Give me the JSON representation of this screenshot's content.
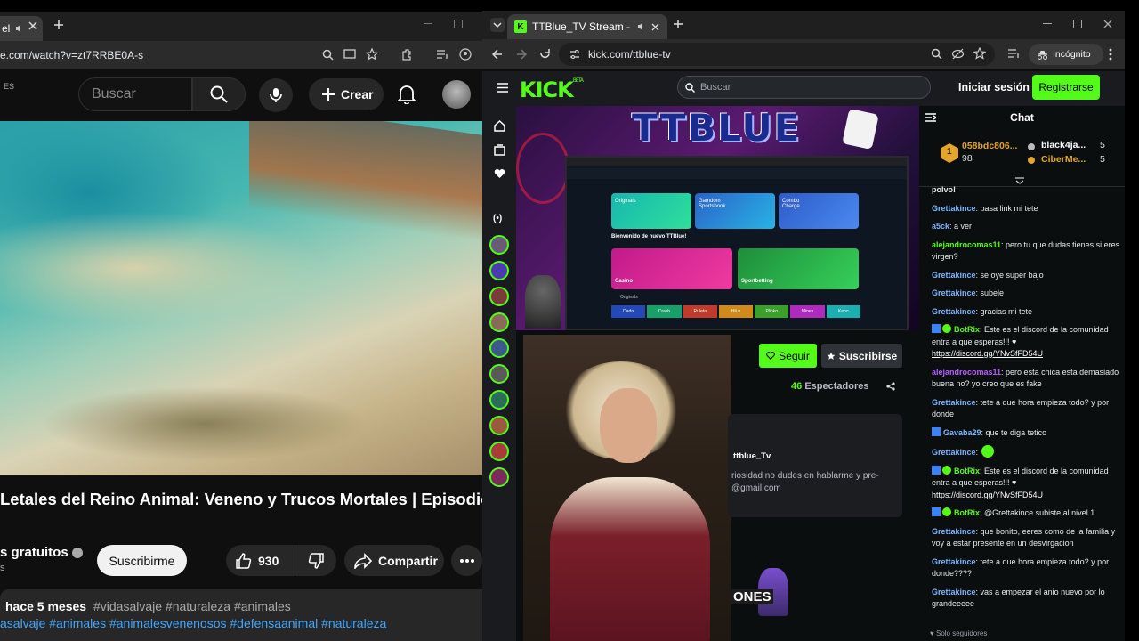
{
  "left_browser": {
    "tab_label": "el",
    "url": "e.com/watch?v=zt7RRBE0A-s"
  },
  "youtube": {
    "logo_suffix": "ES",
    "search_placeholder": "Buscar",
    "create_label": "Crear",
    "video_title": "Letales del Reino Animal: Veneno y Trucos Mortales | Episodio",
    "channel_name": "s gratuitos",
    "channel_sub": "s",
    "subscribe_label": "Suscribirme",
    "like_count": "930",
    "share_label": "Compartir",
    "desc_date": "hace 5 meses",
    "desc_tags_line1": "#vidasalvaje #naturaleza #animales",
    "desc_tags_line2": "asalvaje #animales #animalesvenenosos #defensaanimal #naturaleza"
  },
  "right_browser": {
    "tab_title": "TTBlue_TV Stream - Watch",
    "url": "kick.com/ttblue-tv",
    "incognito_label": "Incógnito"
  },
  "kick": {
    "logo": "KICK",
    "logo_badge": "BETA",
    "search_placeholder": "Buscar",
    "login_label": "Iniciar sesión",
    "register_label": "Registrarse",
    "stream_banner": "TTBLUE",
    "follow_label": "Seguir",
    "subscribe_label": "Suscribirse",
    "viewers_count": "46",
    "viewers_label": "Espectadores",
    "about_name": "ttblue_Tv",
    "about_text": "riosidad no dudes en hablarme y pre-",
    "about_email": "@gmail.com",
    "badge_text": "ONES",
    "accent": "#53fc18"
  },
  "stream_screen": {
    "welcome": "Bienvenido de nuevo TTBlue!",
    "cards": [
      "Originals",
      "Gamdom Sportsbook",
      "Combo Charge",
      "Casino",
      "Sportbetting"
    ],
    "games": [
      "Dado",
      "Crash",
      "Ruleta",
      "HiLo",
      "Plinko",
      "Mines",
      "Keno"
    ],
    "section_label": "Originals"
  },
  "chat": {
    "title": "Chat",
    "top": [
      {
        "rank": "1",
        "name": "058bdc806...",
        "amount": "98",
        "color": "#e3a52b"
      },
      {
        "name": "black4ja...",
        "amount": "5",
        "color": "#ffffff"
      },
      {
        "name": "CiberMe...",
        "amount": "5",
        "color": "#e3a52b"
      }
    ],
    "messages": [
      {
        "user": "",
        "text": "polvo!",
        "color": "#5ea8ff"
      },
      {
        "user": "Grettakince",
        "text": ": pasa link mi tete",
        "color": "#7fb7ff"
      },
      {
        "user": "a5ck",
        "text": ": a ver",
        "color": "#7fb7ff"
      },
      {
        "user": "alejandrocomas11",
        "text": ": pero tu que dudas tienes si eres virgen?",
        "color": "#53fc18"
      },
      {
        "user": "Grettakince",
        "text": ": se oye super bajo",
        "color": "#7fb7ff"
      },
      {
        "user": "Grettakince",
        "text": ": subele",
        "color": "#7fb7ff"
      },
      {
        "user": "Grettakince",
        "text": ": gracias mi tete",
        "color": "#7fb7ff"
      },
      {
        "user": "BotRix",
        "text": ": Este es el discord de la comunidad entra a que esperas!!! ♥",
        "link": "https://discord.gg/YNvSfFD54U",
        "color": "#53fc18"
      },
      {
        "user": "alejandrocomas11",
        "text": ": pero esta chica esta demasiado buena no? yo creo que es fake",
        "color": "#b85cff"
      },
      {
        "user": "Grettakince",
        "text": ": tete a que hora empieza todo? y por donde",
        "color": "#7fb7ff"
      },
      {
        "user": "Gavaba29",
        "text": ": que te diga tetico",
        "color": "#7fb7ff"
      },
      {
        "user": "Grettakince",
        "text": ":",
        "color": "#7fb7ff"
      },
      {
        "user": "BotRix",
        "text": ": Este es el discord de la comunidad entra a que esperas!!! ♥",
        "link": "https://discord.gg/YNvSfFD54U",
        "color": "#53fc18"
      },
      {
        "user": "BotRix",
        "text": ": @Grettakince subiste al nivel 1",
        "color": "#53fc18"
      },
      {
        "user": "Grettakince",
        "text": ": que bonito, eeres como de la familia y voy a estar presente en un desvirgacion",
        "color": "#7fb7ff"
      },
      {
        "user": "Grettakince",
        "text": ": tete a que hora empieza todo? y por donde????",
        "color": "#7fb7ff"
      },
      {
        "user": "Grettakince",
        "text": ": vas a empezar el anio nuevo por lo grandeeeee",
        "color": "#7fb7ff"
      }
    ],
    "followers_only": "Solo seguidores"
  }
}
